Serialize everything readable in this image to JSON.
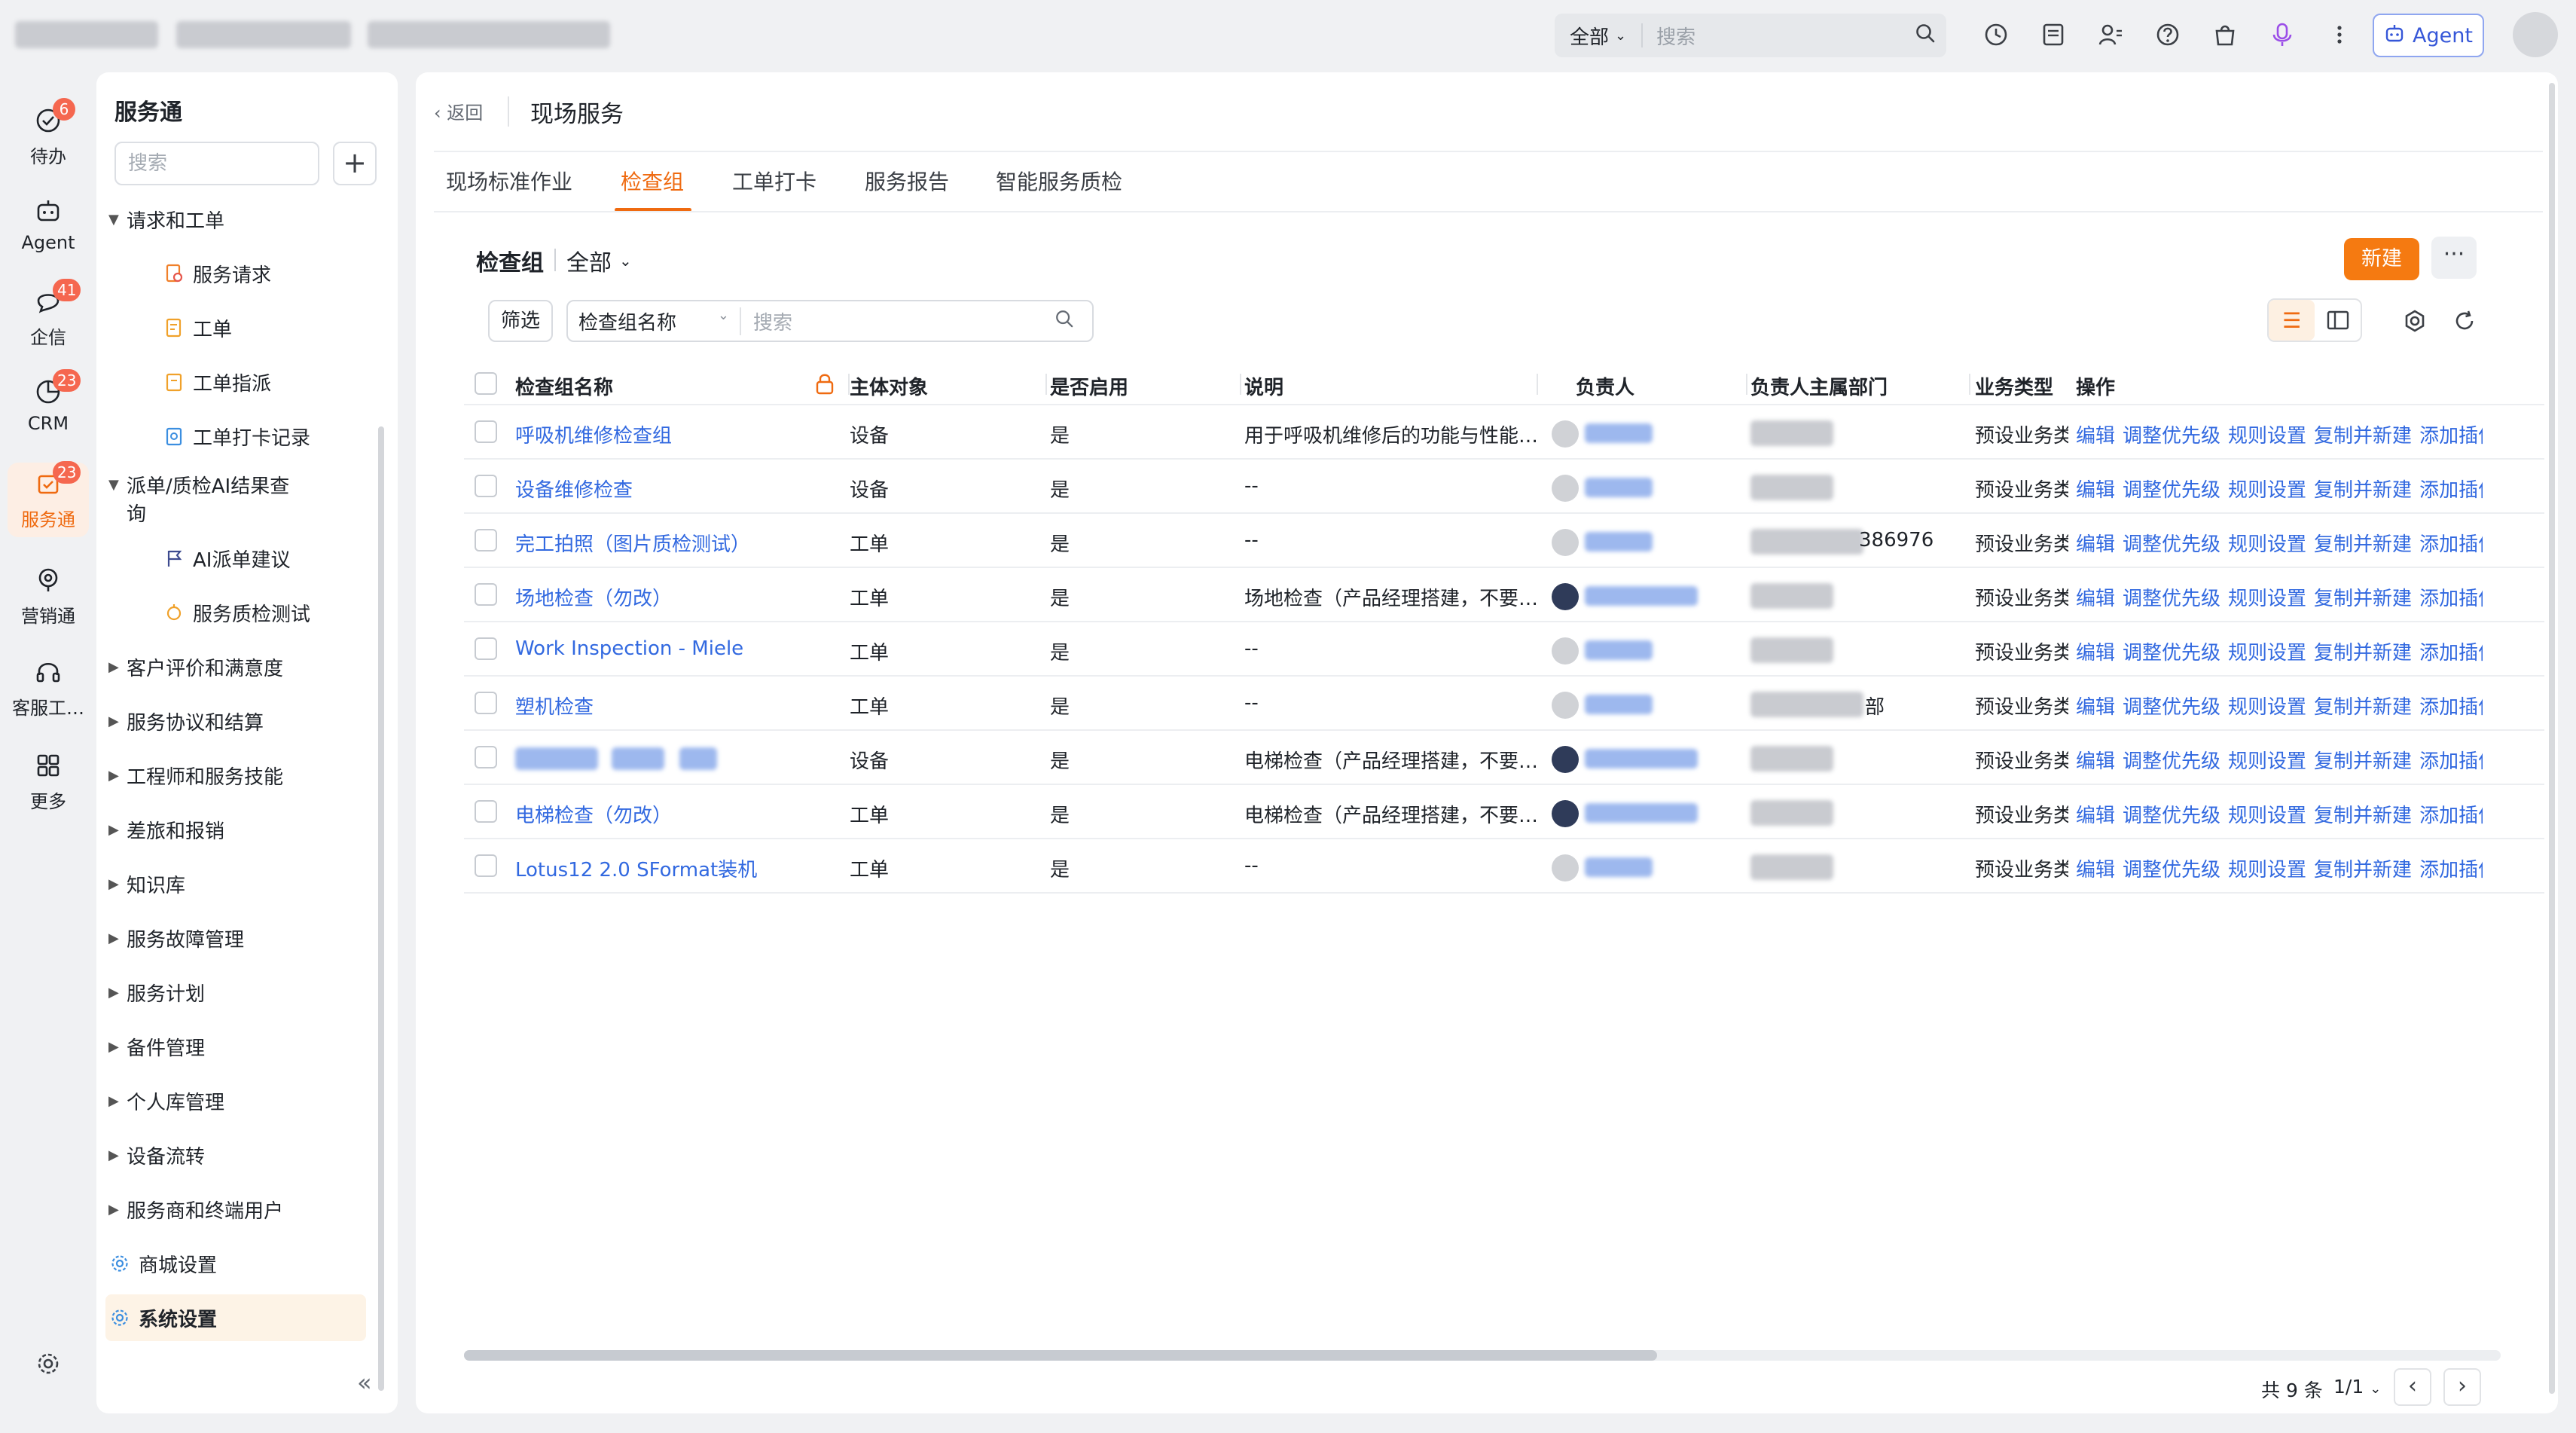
{
  "topbar": {
    "search_scope": "全部",
    "search_placeholder": "搜索",
    "agent_label": "Agent"
  },
  "rail": [
    {
      "label": "待办",
      "icon": "todo-icon",
      "badge": "6"
    },
    {
      "label": "Agent",
      "icon": "agent-icon",
      "badge": ""
    },
    {
      "label": "企信",
      "icon": "chat-icon",
      "badge": "41"
    },
    {
      "label": "CRM",
      "icon": "crm-icon",
      "badge": "23"
    },
    {
      "label": "服务通",
      "icon": "service-icon",
      "badge": "23"
    },
    {
      "label": "营销通",
      "icon": "marketing-icon",
      "badge": ""
    },
    {
      "label": "客服工…",
      "icon": "headset-icon",
      "badge": ""
    },
    {
      "label": "更多",
      "icon": "grid-icon",
      "badge": ""
    }
  ],
  "nav": {
    "title": "服务通",
    "search_placeholder": "搜索",
    "items": [
      {
        "label": "请求和工单",
        "level": 0,
        "caret": "▼",
        "icon": ""
      },
      {
        "label": "服务请求",
        "level": 1,
        "caret": "",
        "icon": "request-icon"
      },
      {
        "label": "工单",
        "level": 1,
        "caret": "",
        "icon": "workorder-icon"
      },
      {
        "label": "工单指派",
        "level": 1,
        "caret": "",
        "icon": "assign-icon"
      },
      {
        "label": "工单打卡记录",
        "level": 1,
        "caret": "",
        "icon": "checkin-icon"
      },
      {
        "label": "派单/质检AI结果查",
        "label2": "询",
        "level": 0,
        "caret": "▼",
        "icon": ""
      },
      {
        "label": "AI派单建议",
        "level": 1,
        "caret": "",
        "icon": "flag-icon"
      },
      {
        "label": "服务质检测试",
        "level": 1,
        "caret": "",
        "icon": "inspect-icon"
      },
      {
        "label": "客户评价和满意度",
        "level": 0,
        "caret": "▶",
        "icon": ""
      },
      {
        "label": "服务协议和结算",
        "level": 0,
        "caret": "▶",
        "icon": ""
      },
      {
        "label": "工程师和服务技能",
        "level": 0,
        "caret": "▶",
        "icon": ""
      },
      {
        "label": "差旅和报销",
        "level": 0,
        "caret": "▶",
        "icon": ""
      },
      {
        "label": "知识库",
        "level": 0,
        "caret": "▶",
        "icon": ""
      },
      {
        "label": "服务故障管理",
        "level": 0,
        "caret": "▶",
        "icon": ""
      },
      {
        "label": "服务计划",
        "level": 0,
        "caret": "▶",
        "icon": ""
      },
      {
        "label": "备件管理",
        "level": 0,
        "caret": "▶",
        "icon": ""
      },
      {
        "label": "个人库管理",
        "level": 0,
        "caret": "▶",
        "icon": ""
      },
      {
        "label": "设备流转",
        "level": 0,
        "caret": "▶",
        "icon": ""
      },
      {
        "label": "服务商和终端用户",
        "level": 0,
        "caret": "▶",
        "icon": ""
      },
      {
        "label": "商城设置",
        "level": 0,
        "caret": "",
        "icon": "gear-icon"
      },
      {
        "label": "系统设置",
        "level": 0,
        "caret": "",
        "icon": "gear-icon",
        "selected": true
      }
    ]
  },
  "main": {
    "back_label": "返回",
    "page_title": "现场服务",
    "tabs": [
      "现场标准作业",
      "检查组",
      "工单打卡",
      "服务报告",
      "智能服务质检"
    ],
    "active_tab": 1,
    "group_title": "检查组",
    "group_scope": "全部",
    "new_label": "新建",
    "filter_label": "筛选",
    "field_select": "检查组名称",
    "field_placeholder": "搜索",
    "columns": [
      "检查组名称",
      "主体对象",
      "是否启用",
      "说明",
      "负责人",
      "负责人主属部门",
      "业务类型",
      "操作"
    ],
    "rows": [
      {
        "name": "呼吸机维修检查组",
        "object": "设备",
        "enabled": "是",
        "desc": "用于呼吸机维修后的功能与性能…",
        "owner": "",
        "dept": "",
        "biz": "预设业务类",
        "avatar": "light"
      },
      {
        "name": "设备维修检查",
        "object": "设备",
        "enabled": "是",
        "desc": "--",
        "owner": "",
        "dept": "",
        "biz": "预设业务类",
        "avatar": "light"
      },
      {
        "name": "完工拍照（图片质检测试）",
        "object": "工单",
        "enabled": "是",
        "desc": "--",
        "owner": "",
        "dept": "386976",
        "biz": "预设业务类",
        "avatar": "light"
      },
      {
        "name": "场地检查（勿改）",
        "object": "工单",
        "enabled": "是",
        "desc": "场地检查（产品经理搭建，不要…",
        "owner": "",
        "dept": "",
        "biz": "预设业务类",
        "avatar": "dark"
      },
      {
        "name": "Work Inspection - Miele",
        "object": "工单",
        "enabled": "是",
        "desc": "--",
        "owner": "",
        "dept": "",
        "biz": "预设业务类",
        "avatar": "light"
      },
      {
        "name": "塑机检查",
        "object": "工单",
        "enabled": "是",
        "desc": "--",
        "owner": "",
        "dept": "部",
        "biz": "预设业务类",
        "avatar": "light"
      },
      {
        "name": "",
        "object": "设备",
        "enabled": "是",
        "desc": "电梯检查（产品经理搭建，不要…",
        "owner": "",
        "dept": "",
        "biz": "预设业务类",
        "avatar": "dark"
      },
      {
        "name": "电梯检查（勿改）",
        "object": "工单",
        "enabled": "是",
        "desc": "电梯检查（产品经理搭建，不要…",
        "owner": "",
        "dept": "",
        "biz": "预设业务类",
        "avatar": "dark"
      },
      {
        "name": "Lotus12 2.0 SFormat装机",
        "object": "工单",
        "enabled": "是",
        "desc": "--",
        "owner": "",
        "dept": "",
        "biz": "预设业务类",
        "avatar": "light"
      }
    ],
    "row_actions": [
      "编辑",
      "调整优先级",
      "规则设置",
      "复制并新建",
      "添加插件"
    ],
    "pager": {
      "total": "共 9 条",
      "page": "1/1"
    }
  }
}
